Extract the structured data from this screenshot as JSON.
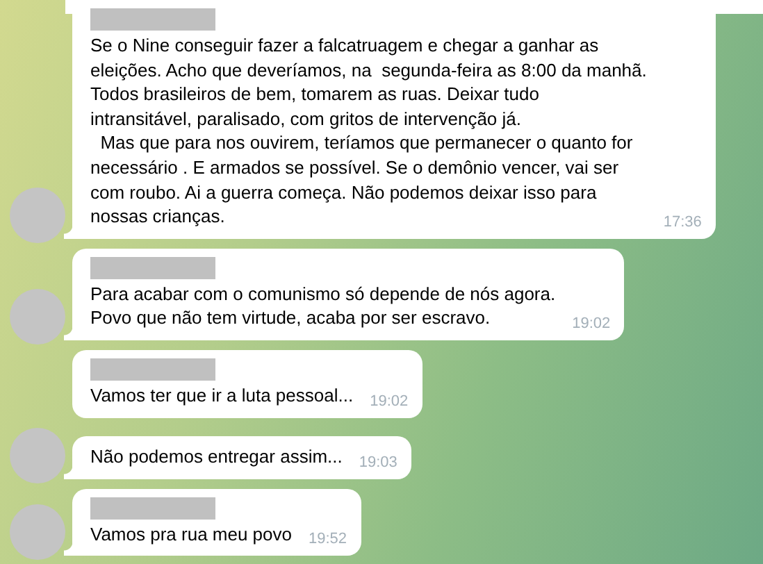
{
  "messages": [
    {
      "sender_hidden": true,
      "avatar": true,
      "text": "Se o Nine conseguir fazer a falcatruagem e chegar a ganhar as\neleições. Acho que deveríamos, na  segunda-feira as 8:00 da manhã.\nTodos brasileiros de bem, tomarem as ruas. Deixar tudo\nintransitável, paralisado, com gritos de intervenção já.\n  Mas que para nos ouvirem, teríamos que permanecer o quanto for\nnecessário . E armados se possível. Se o demônio vencer, vai ser\ncom roubo. Ai a guerra começa. Não podemos deixar isso para\nnossas crianças.",
      "time": "17:36"
    },
    {
      "sender_hidden": true,
      "avatar": true,
      "text": "Para acabar com o comunismo só depende de nós agora.\nPovo que não tem virtude, acaba por ser escravo.",
      "time": "19:02"
    },
    {
      "sender_hidden": true,
      "avatar": false,
      "text": "Vamos ter que ir a luta pessoal...",
      "time": "19:02"
    },
    {
      "sender_hidden": false,
      "avatar": true,
      "text": "Não podemos entregar assim...",
      "time": "19:03"
    },
    {
      "sender_hidden": true,
      "avatar": true,
      "text": "Vamos pra rua meu povo",
      "time": "19:52"
    }
  ]
}
